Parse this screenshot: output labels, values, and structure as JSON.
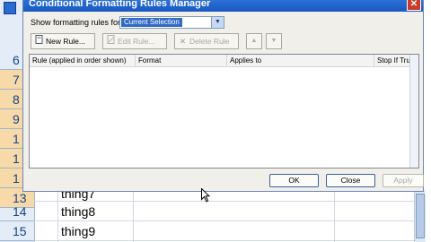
{
  "dialog": {
    "title": "Conditional Formatting Rules Manager",
    "close_glyph": "✕",
    "show_label": "Show formatting rules for:",
    "scope_select": {
      "value": "Current Selection"
    },
    "toolbar": {
      "new_rule": "New Rule...",
      "edit_rule": "Edit Rule...",
      "delete_rule": "Delete Rule",
      "move_up": "▲",
      "move_down": "▼"
    },
    "columns": [
      "Rule (applied in order shown)",
      "Format",
      "Applies to",
      "Stop If True"
    ],
    "buttons": {
      "ok": "OK",
      "close": "Close",
      "apply": "Apply"
    }
  },
  "sheet": {
    "row_numbers": [
      "6",
      "7",
      "8",
      "9",
      "1",
      "1",
      "1",
      "1",
      "13",
      "14",
      "15"
    ],
    "cells": [
      "thing7",
      "thing8",
      "thing9"
    ]
  },
  "icons": {
    "new_rule": "new-document-icon",
    "edit_rule": "edit-pencil-icon",
    "delete_rule": "delete-x-icon",
    "move_up": "arrow-up-icon",
    "move_down": "arrow-down-icon",
    "dropdown": "chevron-down-icon",
    "close": "close-icon",
    "cursor": "mouse-pointer-icon"
  },
  "colors": {
    "title_bar": "#2b71d8",
    "selection": "#316ac5",
    "row_header_selected": "#f8d9a8"
  }
}
